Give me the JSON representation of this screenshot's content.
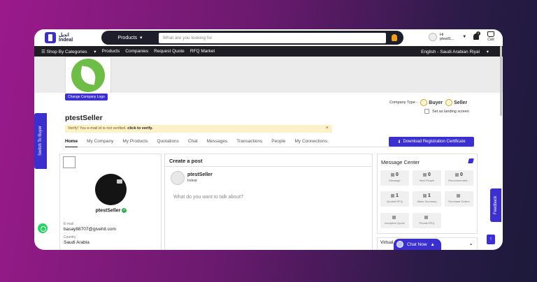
{
  "header": {
    "logo_arabic": "انديل",
    "logo_latin": "Indeal",
    "search_category": "Products",
    "search_placeholder": "What are you looking for",
    "user_hi": "Hi",
    "user_name": "ptestS...",
    "notification_count": "0",
    "cart_label": "Cart"
  },
  "nav": {
    "categories": "Shop By Categories",
    "items": [
      "Products",
      "Companies",
      "Request Quote",
      "RFQ Market"
    ],
    "language": "English - Saudi Arabian Riyal"
  },
  "profile": {
    "change_logo": "Change Company Logo",
    "company_name": "ptestSeller",
    "company_type_label": "Company Type -",
    "type_buyer": "Buyer",
    "type_seller": "Seller",
    "landing_label": "Set as landing screen",
    "verify_msg": "Verify! You e-mail id is not verified.",
    "verify_link": "click to verify.",
    "download_btn": "Download Registration Certificate"
  },
  "tabs": [
    "Home",
    "My Company",
    "My Products",
    "Quotations",
    "Chat",
    "Messages",
    "Transactions",
    "People",
    "My Connections"
  ],
  "profile_card": {
    "name": "ptestSeller",
    "email_label": "E-mail",
    "email": "basay88707@givehit.com",
    "country_label": "Country",
    "country": "Saudi Arabia"
  },
  "post": {
    "title": "Create a post",
    "user": "ptestSeller",
    "company": "Indeal",
    "prompt": "What do you want to talk about?"
  },
  "message_center": {
    "title": "Message Center",
    "tiles": [
      {
        "count": "0",
        "label": "Message"
      },
      {
        "count": "0",
        "label": "New People"
      },
      {
        "count": "0",
        "label": "Recommended..."
      },
      {
        "count": "1",
        "label": "Quoted RFQ"
      },
      {
        "count": "1",
        "label": "Sales Summary"
      },
      {
        "count": "",
        "label": "Purchase Orders"
      },
      {
        "count": "",
        "label": "Accepted Quote"
      },
      {
        "count": "",
        "label": "Private RFQ"
      }
    ]
  },
  "virtual_label": "Virtual",
  "chat_now": "Chat Now",
  "switch_buyer": "Switch To Buyer",
  "feedback": "Feedback",
  "colors": {
    "accent": "#3b2fd0",
    "navbar": "#1d1d23",
    "verify_bg": "#fdf1c8"
  }
}
